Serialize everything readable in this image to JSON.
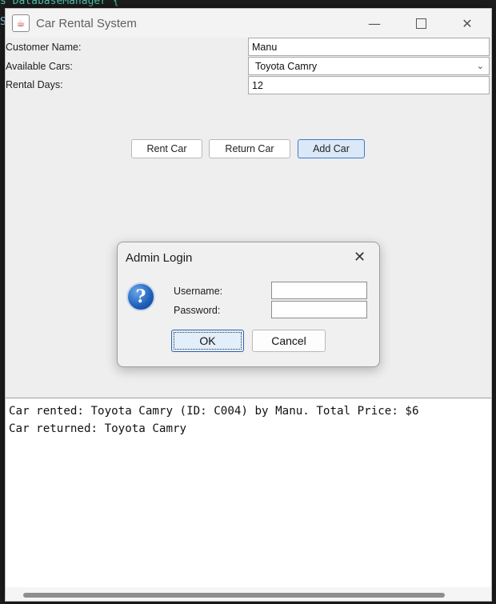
{
  "background": {
    "code_fragment": "s DatabaseManager {"
  },
  "window": {
    "title": "Car Rental System",
    "app_icon": "java-icon",
    "controls": {
      "minimize": "—",
      "close": "✕"
    }
  },
  "form": {
    "customer_label": "Customer Name:",
    "customer_value": "Manu",
    "cars_label": "Available Cars:",
    "cars_selected": "Toyota Camry",
    "days_label": "Rental Days:",
    "days_value": "12"
  },
  "buttons": {
    "rent": "Rent Car",
    "return": "Return Car",
    "add": "Add Car"
  },
  "log": {
    "lines": [
      "Car rented: Toyota Camry (ID: C004) by Manu. Total Price: $6",
      "Car returned: Toyota Camry"
    ]
  },
  "dialog": {
    "title": "Admin Login",
    "icon": "question-icon",
    "username_label": "Username:",
    "username_value": "",
    "password_label": "Password:",
    "password_value": "",
    "ok": "OK",
    "cancel": "Cancel"
  },
  "colors": {
    "focus_blue": "#3b7ac8",
    "question_icon_blue": "#1f5fb8"
  }
}
